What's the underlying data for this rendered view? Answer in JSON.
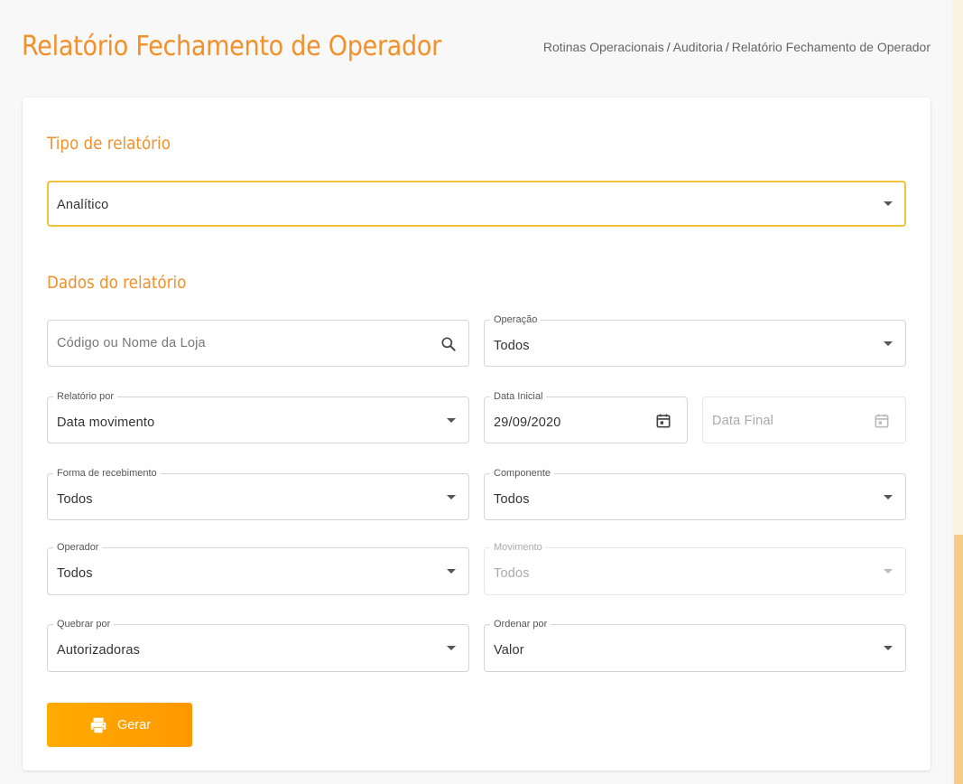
{
  "header": {
    "title": "Relatório Fechamento de Operador",
    "breadcrumb": [
      "Rotinas Operacionais",
      "Auditoria",
      "Relatório Fechamento de Operador"
    ],
    "separator": "/"
  },
  "sections": {
    "tipo": "Tipo de relatório",
    "dados": "Dados do relatório"
  },
  "fields": {
    "tipo_relatorio": {
      "value": "Analítico"
    },
    "loja": {
      "placeholder": "Código ou Nome da Loja",
      "icon": "search-icon"
    },
    "operacao": {
      "label": "Operação",
      "value": "Todos"
    },
    "relatorio_por": {
      "label": "Relatório por",
      "value": "Data movimento"
    },
    "data_inicial": {
      "label": "Data Inicial",
      "value": "29/09/2020",
      "icon": "calendar-icon"
    },
    "data_final": {
      "placeholder": "Data Final",
      "icon": "calendar-icon",
      "disabled": true
    },
    "forma_recebimento": {
      "label": "Forma de recebimento",
      "value": "Todos"
    },
    "componente": {
      "label": "Componente",
      "value": "Todos"
    },
    "operador": {
      "label": "Operador",
      "value": "Todos"
    },
    "movimento": {
      "label": "Movimento",
      "value": "Todos",
      "disabled": true
    },
    "quebrar_por": {
      "label": "Quebrar por",
      "value": "Autorizadoras"
    },
    "ordenar_por": {
      "label": "Ordenar por",
      "value": "Valor"
    }
  },
  "actions": {
    "gerar_label": "Gerar",
    "gerar_icon": "printer-icon"
  },
  "colors": {
    "accent": "#f2902a",
    "focus_border": "#f0c23c",
    "button_start": "#ffab00",
    "button_end": "#ff9800",
    "scrollbar_thumb": "#f5c98a"
  }
}
